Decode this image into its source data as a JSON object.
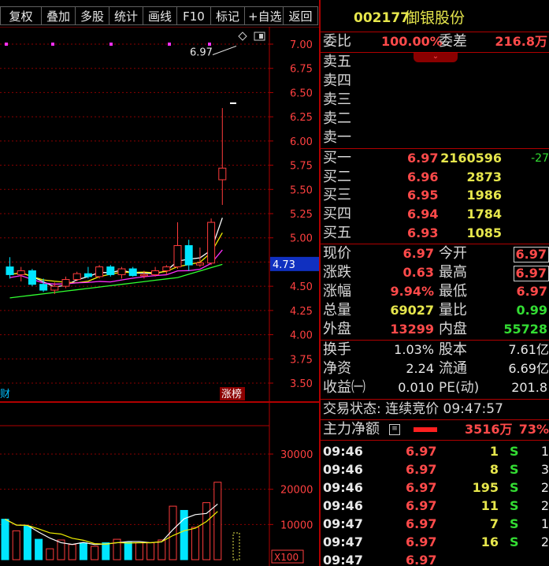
{
  "toolbar": {
    "items": [
      "复权",
      "叠加",
      "多股",
      "统计",
      "画线",
      "F10",
      "标记",
      "+自选",
      "返回"
    ]
  },
  "kline": {
    "price_axis_labels": [
      "7.00",
      "6.75",
      "6.50",
      "6.25",
      "6.00",
      "5.75",
      "5.50",
      "5.25",
      "5.00",
      "4.75",
      "4.50",
      "4.25",
      "4.00",
      "3.75",
      "3.50"
    ],
    "current_price_tag": "4.73",
    "high_annotation": "6.97",
    "tag_left": "财",
    "tag_right": "涨榜",
    "volume_axis_labels": [
      "30000",
      "20000",
      "10000"
    ],
    "volume_unit": "X100",
    "colors": {
      "up": "#ff3c3c",
      "down": "#00e5ff",
      "ma5": "#ffffff",
      "ma10": "#f0f000",
      "ma20": "#ff30ff",
      "ma60": "#30ff30",
      "grid": "#8b0000"
    }
  },
  "chart_data": {
    "type": "candlestick",
    "candles": [
      {
        "o": 4.7,
        "h": 4.8,
        "l": 4.58,
        "c": 4.62
      },
      {
        "o": 4.62,
        "h": 4.7,
        "l": 4.55,
        "c": 4.66
      },
      {
        "o": 4.66,
        "h": 4.68,
        "l": 4.5,
        "c": 4.52
      },
      {
        "o": 4.52,
        "h": 4.58,
        "l": 4.44,
        "c": 4.46
      },
      {
        "o": 4.46,
        "h": 4.54,
        "l": 4.42,
        "c": 4.5
      },
      {
        "o": 4.5,
        "h": 4.6,
        "l": 4.48,
        "c": 4.57
      },
      {
        "o": 4.57,
        "h": 4.65,
        "l": 4.55,
        "c": 4.63
      },
      {
        "o": 4.63,
        "h": 4.7,
        "l": 4.58,
        "c": 4.6
      },
      {
        "o": 4.6,
        "h": 4.72,
        "l": 4.58,
        "c": 4.7
      },
      {
        "o": 4.7,
        "h": 4.72,
        "l": 4.6,
        "c": 4.62
      },
      {
        "o": 4.62,
        "h": 4.7,
        "l": 4.58,
        "c": 4.68
      },
      {
        "o": 4.68,
        "h": 4.7,
        "l": 4.6,
        "c": 4.61
      },
      {
        "o": 4.61,
        "h": 4.66,
        "l": 4.58,
        "c": 4.62
      },
      {
        "o": 4.62,
        "h": 4.7,
        "l": 4.6,
        "c": 4.66
      },
      {
        "o": 4.66,
        "h": 4.72,
        "l": 4.62,
        "c": 4.7
      },
      {
        "o": 4.7,
        "h": 5.16,
        "l": 4.68,
        "c": 4.92
      },
      {
        "o": 4.92,
        "h": 4.98,
        "l": 4.66,
        "c": 4.72
      },
      {
        "o": 4.72,
        "h": 4.9,
        "l": 4.7,
        "c": 4.74
      },
      {
        "o": 4.74,
        "h": 5.2,
        "l": 4.72,
        "c": 5.16
      },
      {
        "o": 5.6,
        "h": 6.34,
        "l": 5.34,
        "c": 5.72
      }
    ],
    "volume": [
      1150,
      820,
      950,
      580,
      310,
      560,
      430,
      480,
      380,
      480,
      580,
      490,
      480,
      480,
      560,
      1520,
      1400,
      920,
      1620,
      2200,
      760
    ],
    "ylim": [
      3.5,
      7.0
    ],
    "volume_ylim": [
      0,
      30000
    ]
  },
  "quote": {
    "code": "002177",
    "name": "御银股份",
    "weibi_label": "委比",
    "weibi_value": "100.00%",
    "weicha_label": "委差",
    "weicha_value": "216.8万",
    "sell_levels": [
      {
        "label": "卖五"
      },
      {
        "label": "卖四"
      },
      {
        "label": "卖三"
      },
      {
        "label": "卖二"
      },
      {
        "label": "卖一"
      }
    ],
    "buy_levels": [
      {
        "label": "买一",
        "price": "6.97",
        "volume": "2160596",
        "change": "-27"
      },
      {
        "label": "买二",
        "price": "6.96",
        "volume": "2873",
        "change": ""
      },
      {
        "label": "买三",
        "price": "6.95",
        "volume": "1986",
        "change": ""
      },
      {
        "label": "买四",
        "price": "6.94",
        "volume": "1784",
        "change": ""
      },
      {
        "label": "买五",
        "price": "6.93",
        "volume": "1085",
        "change": ""
      }
    ],
    "stats": {
      "xianjia_label": "现价",
      "xianjia": "6.97",
      "jinkai_label": "今开",
      "jinkai": "6.97",
      "zhangdie_label": "涨跌",
      "zhangdie": "0.63",
      "zuigao_label": "最高",
      "zuigao": "6.97",
      "zhangfu_label": "涨幅",
      "zhangfu": "9.94%",
      "zuidi_label": "最低",
      "zuidi": "6.97",
      "zongliang_label": "总量",
      "zongliang": "69027",
      "liangbi_label": "量比",
      "liangbi": "0.99",
      "waipan_label": "外盘",
      "waipan": "13299",
      "neipan_label": "内盘",
      "neipan": "55728",
      "huanshou_label": "换手",
      "huanshou": "1.03%",
      "guben_label": "股本",
      "guben": "7.61亿",
      "jingzi_label": "净资",
      "jingzi": "2.24",
      "liutong_label": "流通",
      "liutong": "6.69亿",
      "shouyi_label": "收益㈠",
      "shouyi": "0.010",
      "pe_label": "PE(动)",
      "pe": "201.8"
    },
    "trade_status": "交易状态: 连续竞价 09:47:57",
    "main_force_label": "主力净额",
    "main_force_value": "3516万",
    "main_force_pct": "73%",
    "ticks": [
      {
        "time": "09:46",
        "price": "6.97",
        "vol": "1",
        "bs": "S",
        "n": "1"
      },
      {
        "time": "09:46",
        "price": "6.97",
        "vol": "8",
        "bs": "S",
        "n": "3"
      },
      {
        "time": "09:46",
        "price": "6.97",
        "vol": "195",
        "bs": "S",
        "n": "2"
      },
      {
        "time": "09:46",
        "price": "6.97",
        "vol": "11",
        "bs": "S",
        "n": "2"
      },
      {
        "time": "09:47",
        "price": "6.97",
        "vol": "7",
        "bs": "S",
        "n": "1"
      },
      {
        "time": "09:47",
        "price": "6.97",
        "vol": "16",
        "bs": "S",
        "n": "2"
      },
      {
        "time": "09:47",
        "price": "6.97",
        "vol": "",
        "bs": "",
        "n": ""
      }
    ]
  }
}
